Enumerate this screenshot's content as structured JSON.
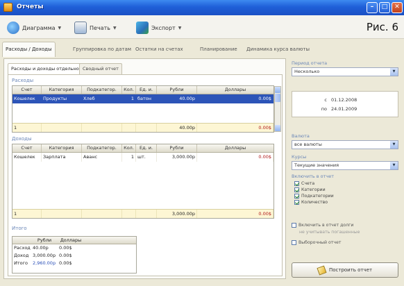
{
  "window": {
    "title": "Отчеты"
  },
  "toolbar": {
    "diagram_label": "Диаграмма",
    "print_label": "Печать",
    "export_label": "Экспорт",
    "figure_label": "Рис. 6"
  },
  "main_tabs": [
    "Расходы / Доходы",
    "Группировка по датам",
    "Остатки на счетах",
    "Планирование",
    "Динамика курса валюты"
  ],
  "sub_tabs": [
    "Расходы и доходы отдельно",
    "Сводный отчет"
  ],
  "expenses": {
    "label": "Расходы",
    "columns": [
      "Счет",
      "Категория",
      "Подкатегор.",
      "Кол.",
      "Ед. и.",
      "Рубли",
      "Доллары"
    ],
    "rows": [
      [
        "Кошелек",
        "Продукты",
        "Хлеб",
        "1",
        "батон",
        "40.00р",
        "0.00$"
      ]
    ],
    "total": {
      "count": "1",
      "rub": "40.00р",
      "usd": "0.00$"
    }
  },
  "income": {
    "label": "Доходы",
    "columns": [
      "Счет",
      "Категория",
      "Подкатегор.",
      "Кол.",
      "Ед. и.",
      "Рубли",
      "Доллары"
    ],
    "rows": [
      [
        "Кошелек",
        "Зарплата",
        "Аванс",
        "1",
        "шт.",
        "3,000.00р",
        "0.00$"
      ]
    ],
    "total": {
      "count": "1",
      "rub": "3,000.00р",
      "usd": "0.00$"
    }
  },
  "summary": {
    "label": "Итого",
    "col_rub": "Рубли",
    "col_usd": "Доллары",
    "rows": [
      {
        "name": "Расход",
        "rub": "40.00р",
        "usd": "0.00$"
      },
      {
        "name": "Доход",
        "rub": "3,000.00р",
        "usd": "0.00$"
      },
      {
        "name": "Итого",
        "rub": "2,960.00р",
        "usd": "0.00$"
      }
    ]
  },
  "side": {
    "period_label": "Период отчета",
    "period_value": "Несколько",
    "from_label": "с",
    "from_date": "01.12.2008",
    "to_label": "по",
    "to_date": "24.01.2009",
    "currency_label": "Валюта",
    "currency_value": "все валюты",
    "rate_label": "Курсы",
    "rate_value": "Текущие значения",
    "include_label": "Включить в отчет",
    "include_items": [
      "Счета",
      "Категории",
      "Подкатегории",
      "Количество"
    ],
    "extra1_text": "Включить в отчет долги",
    "extra1_sub": "не учитывать погашенные",
    "extra2_text": "Выборочный отчет",
    "build_button": "Построить отчет"
  }
}
